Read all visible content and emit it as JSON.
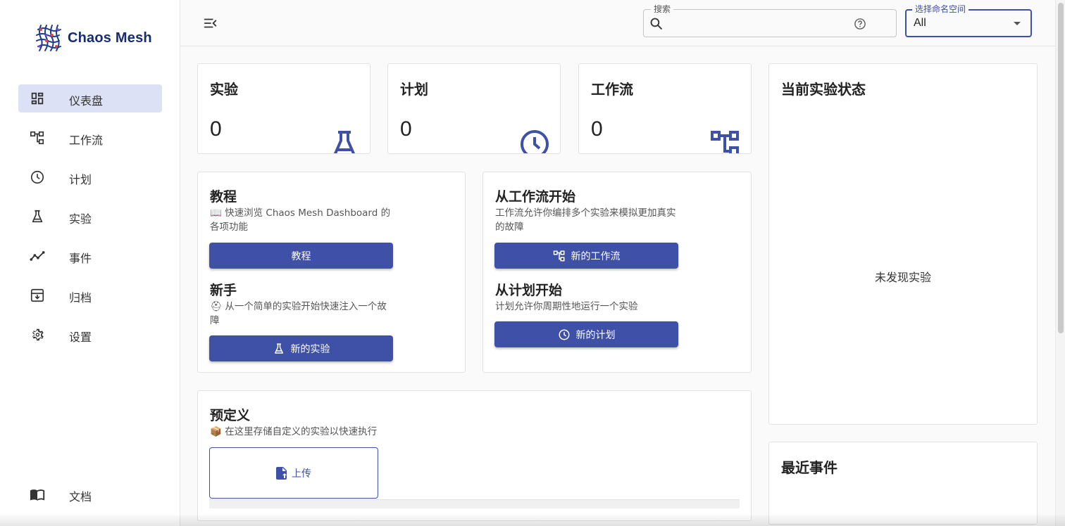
{
  "app": {
    "name": "Chaos Mesh"
  },
  "sidebar": {
    "items": [
      {
        "label": "仪表盘",
        "icon": "dashboard-icon",
        "active": true
      },
      {
        "label": "工作流",
        "icon": "workflow-icon"
      },
      {
        "label": "计划",
        "icon": "clock-icon"
      },
      {
        "label": "实验",
        "icon": "flask-icon"
      },
      {
        "label": "事件",
        "icon": "timeline-icon"
      },
      {
        "label": "归档",
        "icon": "archive-icon"
      },
      {
        "label": "设置",
        "icon": "gear-icon"
      }
    ],
    "docs_label": "文档"
  },
  "header": {
    "search": {
      "legend": "搜索",
      "value": "",
      "placeholder": ""
    },
    "namespace": {
      "legend": "选择命名空间",
      "value": "All"
    }
  },
  "stats": [
    {
      "title": "实验",
      "value": "0",
      "icon": "flask-icon"
    },
    {
      "title": "计划",
      "value": "0",
      "icon": "clock-icon"
    },
    {
      "title": "工作流",
      "value": "0",
      "icon": "workflow-icon"
    }
  ],
  "welcome": {
    "tutorial": {
      "title": "教程",
      "desc": "📖 快速浏览 Chaos Mesh Dashboard 的各项功能",
      "button": "教程"
    },
    "newbie": {
      "title": "新手",
      "desc": "⛑ 从一个简单的实验开始快速注入一个故障",
      "button": "新的实验"
    },
    "workflow": {
      "title": "从工作流开始",
      "desc": "工作流允许你编排多个实验来模拟更加真实的故障",
      "button": "新的工作流"
    },
    "schedule": {
      "title": "从计划开始",
      "desc": "计划允许你周期性地运行一个实验",
      "button": "新的计划"
    }
  },
  "predefined": {
    "title": "预定义",
    "desc": "📦 在这里存储自定义的实验以快速执行",
    "upload_label": "上传"
  },
  "status_panel": {
    "title": "当前实验状态",
    "empty": "未发现实验"
  },
  "events_panel": {
    "title": "最近事件"
  },
  "colors": {
    "primary": "#3f51a6",
    "active_nav_bg": "#dde1f6",
    "logo_text": "#172d72"
  }
}
